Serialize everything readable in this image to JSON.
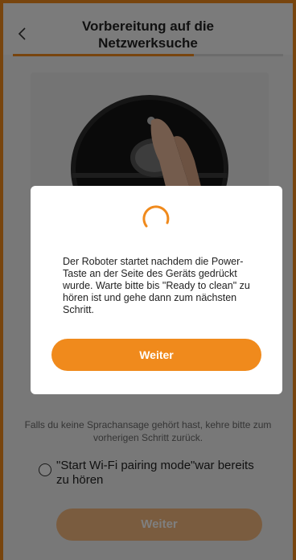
{
  "header": {
    "title": "Vorbereitung auf die Netzwerksuche",
    "progress_fraction": 0.67
  },
  "illustration": {
    "alt_name": "robot-power-button-illustration"
  },
  "main": {
    "hint_text": "Falls du keine Sprachansage gehört hast, kehre bitte zum vorherigen Schritt zurück.",
    "confirm_label": "\"Start Wi-Fi pairing mode\"war bereits zu hören",
    "confirm_checked": false,
    "next_label": "Weiter"
  },
  "modal": {
    "message": "Der Roboter startet nachdem die Power-Taste an der Seite des Geräts gedrückt wurde. Warte bitte bis \"Ready to clean\" zu hören ist und gehe dann zum nächsten Schritt.",
    "button_label": "Weiter"
  },
  "colors": {
    "accent": "#f08a1c",
    "accent_disabled": "#f5b97e"
  }
}
